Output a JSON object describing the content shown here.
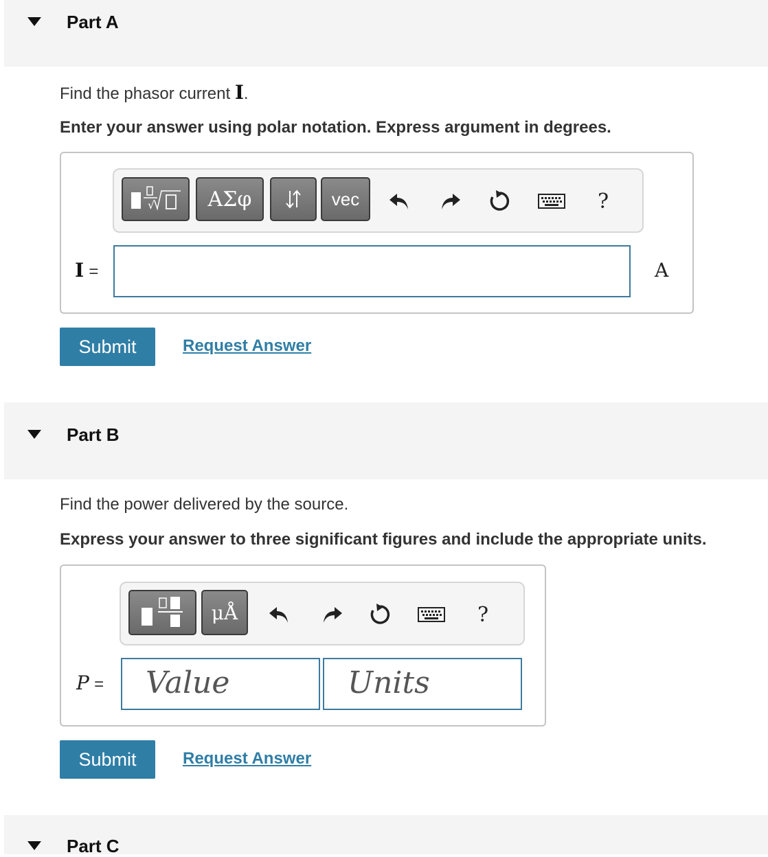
{
  "partA": {
    "title": "Part A",
    "question_prefix": "Find the phasor current ",
    "question_symbol": "I",
    "question_suffix": ".",
    "instruction": "Enter your answer using polar notation. Express argument in degrees.",
    "toolbar": {
      "greek_label": "ΑΣφ",
      "vec_label": "vec",
      "help_label": "?"
    },
    "input_label_symbol": "I",
    "input_label_eq": "=",
    "input_value": "",
    "unit": "A",
    "submit_label": "Submit",
    "request_label": "Request Answer"
  },
  "partB": {
    "title": "Part B",
    "question": "Find the power delivered by the source.",
    "instruction": "Express your answer to three significant figures and include the appropriate units.",
    "toolbar": {
      "units_label": "μÅ",
      "help_label": "?"
    },
    "input_label_symbol": "P",
    "input_label_eq": "=",
    "value_placeholder": "Value",
    "units_placeholder": "Units",
    "submit_label": "Submit",
    "request_label": "Request Answer"
  },
  "partC": {
    "title": "Part C"
  },
  "icons": {
    "caret": "caret-down-icon",
    "undo": "undo-icon",
    "redo": "redo-icon",
    "reset": "reset-icon",
    "keyboard": "keyboard-icon",
    "help": "help-icon",
    "templates": "templates-icon",
    "fraction": "fraction-icon",
    "swap": "swap-arrows-icon"
  },
  "colors": {
    "accent": "#2f7ea6",
    "input_border": "#3d7a9e",
    "header_bg": "#f4f4f4"
  }
}
